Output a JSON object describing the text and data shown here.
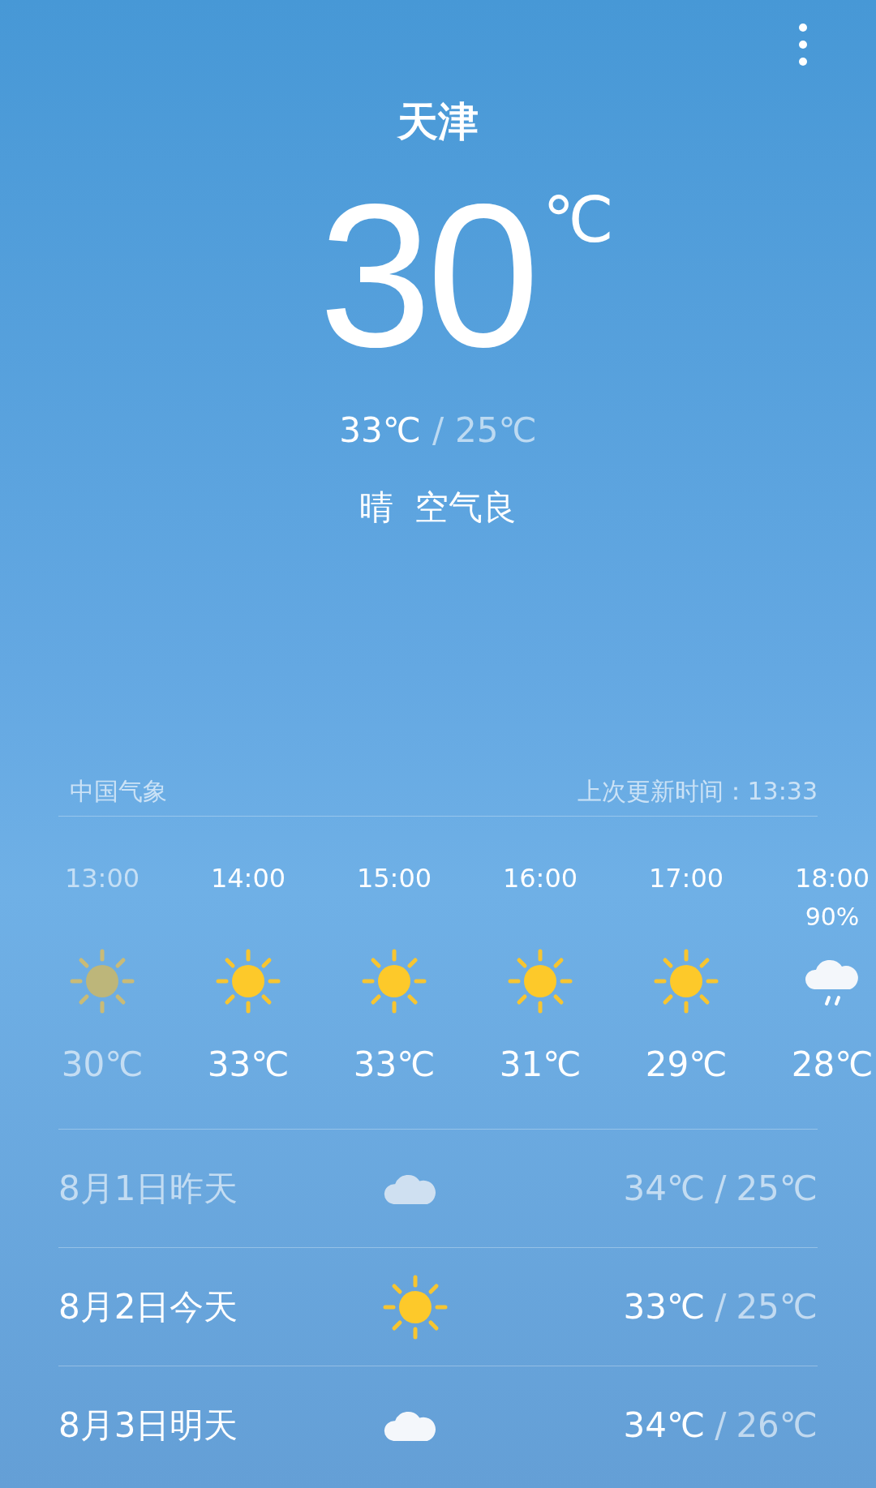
{
  "city": "天津",
  "current": {
    "temp": "30",
    "unit": "℃",
    "high": "33℃",
    "separator": "/",
    "low": "25℃",
    "condition": "晴",
    "air": "空气良"
  },
  "source": "中国气象",
  "updated": "上次更新时间：13:33",
  "hourly": [
    {
      "time": "13:00",
      "kind": "sun",
      "past": true,
      "temp": "30℃"
    },
    {
      "time": "14:00",
      "kind": "sun",
      "past": false,
      "temp": "33℃"
    },
    {
      "time": "15:00",
      "kind": "sun",
      "past": false,
      "temp": "33℃"
    },
    {
      "time": "16:00",
      "kind": "sun",
      "past": false,
      "temp": "31℃"
    },
    {
      "time": "17:00",
      "kind": "sun",
      "past": false,
      "temp": "29℃"
    },
    {
      "time": "18:00",
      "precip": "90%",
      "kind": "rain",
      "past": false,
      "temp": "28℃"
    }
  ],
  "daily": [
    {
      "date": "8月1日昨天",
      "kind": "cloud",
      "past": true,
      "high": "34℃",
      "separator": "/",
      "low": "25℃"
    },
    {
      "date": "8月2日今天",
      "kind": "sun",
      "past": false,
      "high": "33℃",
      "separator": "/",
      "low": "25℃"
    },
    {
      "date": "8月3日明天",
      "kind": "cloud",
      "past": false,
      "high": "34℃",
      "separator": "/",
      "low": "26℃"
    }
  ]
}
